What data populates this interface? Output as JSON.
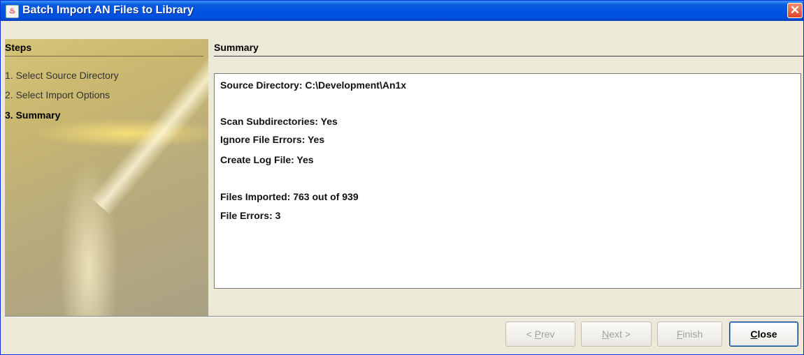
{
  "window": {
    "title": "Batch Import AN Files to Library",
    "close_glyph": "✕",
    "app_icon": "java-coffee-cup-icon"
  },
  "steps": {
    "title": "Steps",
    "items": [
      {
        "label": "1. Select Source Directory",
        "active": false
      },
      {
        "label": "2. Select Import Options",
        "active": false
      },
      {
        "label": "3. Summary",
        "active": true
      }
    ]
  },
  "main": {
    "title": "Summary",
    "lines": [
      "Source Directory: C:\\Development\\An1x",
      "Scan Subdirectories: Yes",
      "Ignore File Errors: Yes",
      "Create Log File: Yes",
      "Files Imported: 763 out of 939",
      "File Errors: 3"
    ]
  },
  "buttons": {
    "prev": {
      "pre": "< ",
      "mnemonic": "P",
      "post": "rev"
    },
    "next": {
      "pre": "",
      "mnemonic": "N",
      "post": "ext >"
    },
    "finish": {
      "pre": "",
      "mnemonic": "F",
      "post": "inish"
    },
    "close": {
      "pre": "",
      "mnemonic": "C",
      "post": "lose"
    }
  },
  "colors": {
    "titlebar": "#0053e1",
    "window_bg": "#ece9d8",
    "close_button": "#e0452a"
  }
}
